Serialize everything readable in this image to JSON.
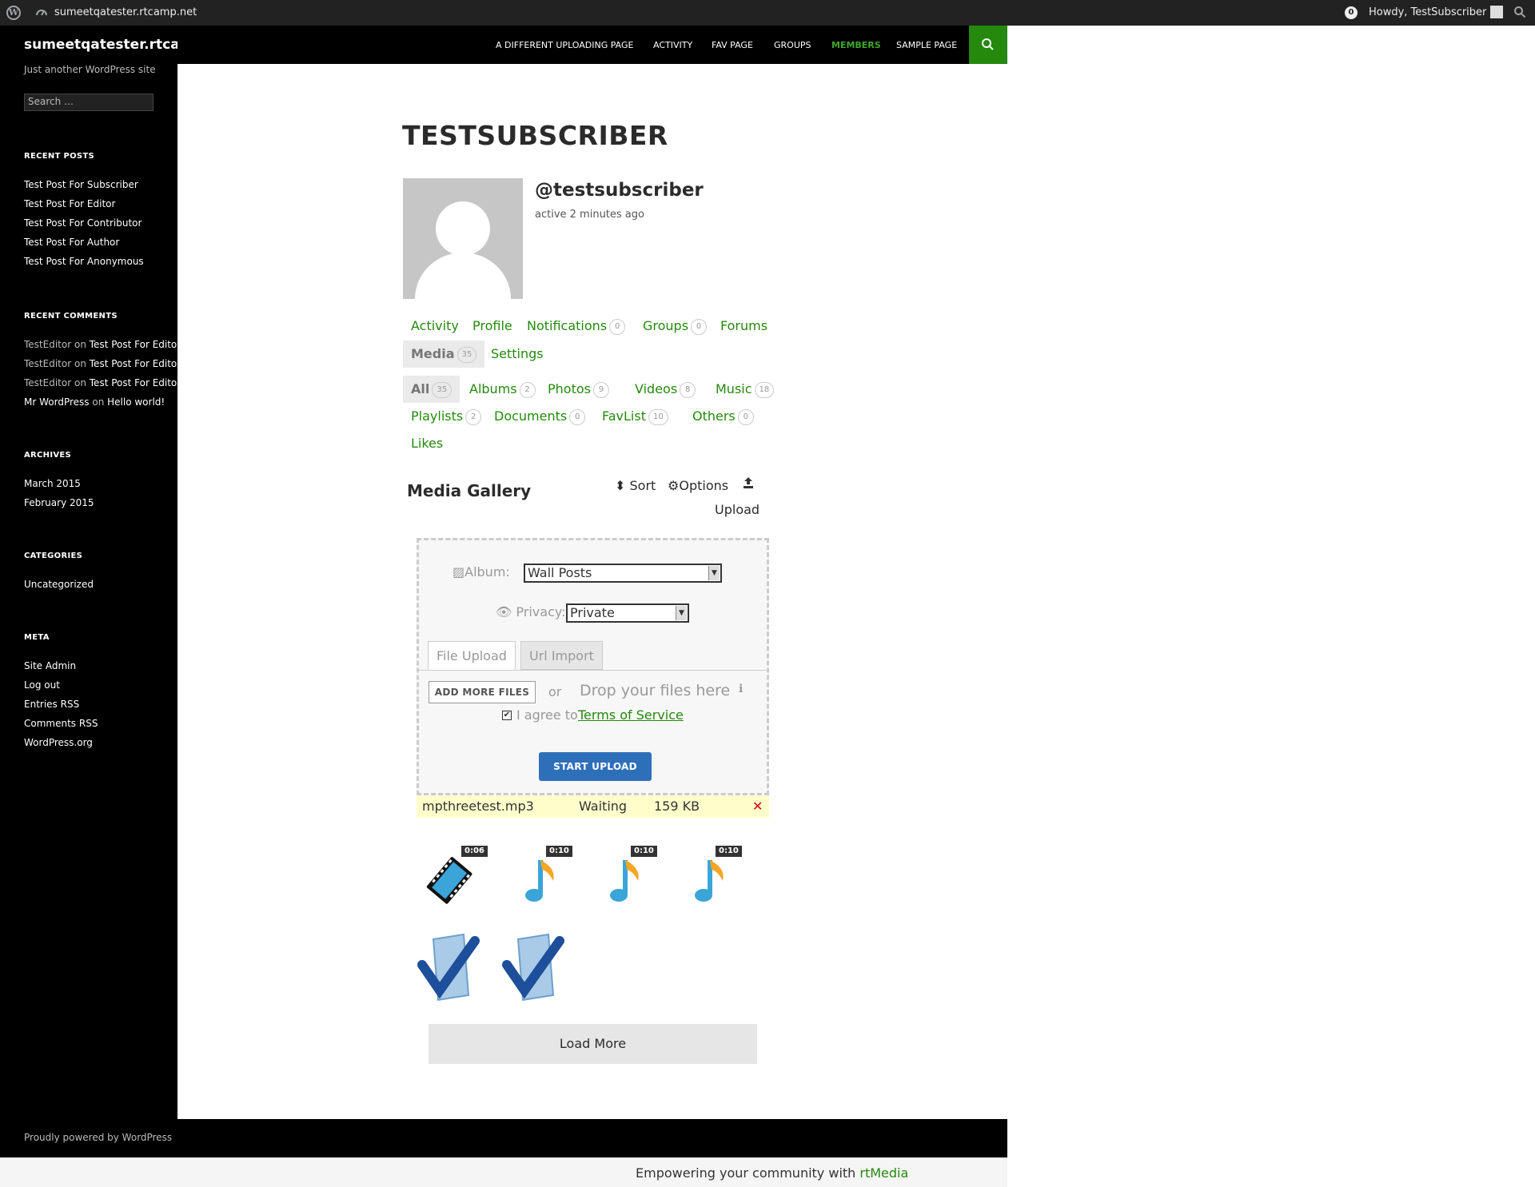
{
  "adminbar": {
    "site_name": "sumeetqatester.rtcamp.net",
    "notifications": "0",
    "howdy": "Howdy, TestSubscriber"
  },
  "sidebar": {
    "site_title": "sumeetqatester.rtcamp.net",
    "tagline": "Just another WordPress site",
    "search_placeholder": "Search …",
    "recent_posts": {
      "title": "RECENT POSTS",
      "items": [
        "Test Post For Subscriber",
        "Test Post For Editor",
        "Test Post For Contributor",
        "Test Post For Author",
        "Test Post For Anonymous"
      ]
    },
    "recent_comments": {
      "title": "RECENT COMMENTS",
      "items": [
        {
          "author": "TestEditor",
          "on": "on",
          "post": "Test Post For Editor"
        },
        {
          "author": "TestEditor",
          "on": "on",
          "post": "Test Post For Editor"
        },
        {
          "author": "TestEditor",
          "on": "on",
          "post": "Test Post For Editor"
        },
        {
          "author": "Mr WordPress",
          "on": "on",
          "post": "Hello world!"
        }
      ]
    },
    "archives": {
      "title": "ARCHIVES",
      "items": [
        "March 2015",
        "February 2015"
      ]
    },
    "categories": {
      "title": "CATEGORIES",
      "items": [
        "Uncategorized"
      ]
    },
    "meta": {
      "title": "META",
      "items": [
        "Site Admin",
        "Log out",
        "Entries RSS",
        "Comments RSS",
        "WordPress.org"
      ]
    }
  },
  "nav": {
    "items": [
      "A DIFFERENT UPLOADING PAGE",
      "ACTIVITY",
      "FAV PAGE",
      "GROUPS",
      "MEMBERS",
      "SAMPLE PAGE"
    ],
    "active": "MEMBERS"
  },
  "profile": {
    "title": "TESTSUBSCRIBER",
    "username": "@testsubscriber",
    "last_active": "active 2 minutes ago"
  },
  "main_tabs": {
    "activity": "Activity",
    "profile": "Profile",
    "notifications": "Notifications",
    "notifications_count": "0",
    "groups": "Groups",
    "groups_count": "0",
    "forums": "Forums",
    "media": "Media",
    "media_count": "35",
    "settings": "Settings"
  },
  "media_tabs": {
    "all": "All",
    "all_count": "35",
    "albums": "Albums",
    "albums_count": "2",
    "photos": "Photos",
    "photos_count": "9",
    "videos": "Videos",
    "videos_count": "8",
    "music": "Music",
    "music_count": "18",
    "playlists": "Playlists",
    "playlists_count": "2",
    "documents": "Documents",
    "documents_count": "0",
    "favlist": "FavList",
    "favlist_count": "10",
    "others": "Others",
    "others_count": "0",
    "likes": "Likes"
  },
  "gallery": {
    "title": "Media Gallery",
    "sort": "Sort",
    "options": "Options",
    "upload": "Upload"
  },
  "uploader": {
    "album_label": "Album:",
    "album_value": "Wall Posts",
    "privacy_label": "Privacy:",
    "privacy_value": "Private",
    "tab_file": "File Upload",
    "tab_url": "Url Import",
    "add_more": "ADD MORE FILES",
    "or": "or",
    "drop": "Drop your files here",
    "agree": "I agree to",
    "tos": "Terms of Service",
    "start": "START UPLOAD",
    "queue": {
      "file": "mpthreetest.mp3",
      "status": "Waiting",
      "size": "159 KB"
    }
  },
  "thumbnails": [
    {
      "icon": "video-file-icon",
      "duration": "0:06"
    },
    {
      "icon": "music-note-icon",
      "duration": "0:10"
    },
    {
      "icon": "music-note-icon",
      "duration": "0:10"
    },
    {
      "icon": "music-note-icon",
      "duration": "0:10"
    },
    {
      "icon": "checkmark-doc-icon"
    },
    {
      "icon": "checkmark-doc-icon"
    }
  ],
  "load_more": "Load More",
  "footer": {
    "powered": "Proudly powered by WordPress"
  },
  "rtbar": {
    "text": "Empowering your community with",
    "brand": "rtMedia"
  },
  "colors": {
    "accent": "#24890d",
    "active_nav": "#41a62a",
    "upload_button": "#2e6fba",
    "queue_bg": "#ffffcc"
  }
}
